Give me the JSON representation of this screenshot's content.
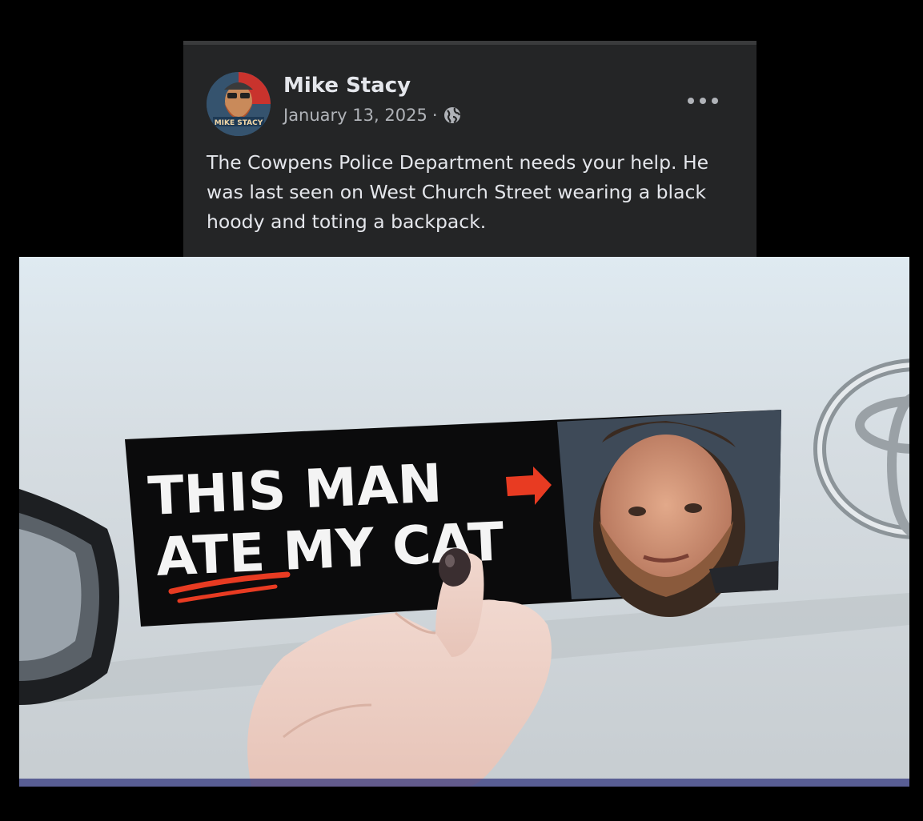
{
  "post": {
    "author": "Mike Stacy",
    "date": "January 13, 2025",
    "separator": "·",
    "audience_icon": "globe-icon",
    "more_icon": "more-options-icon",
    "text": "The Cowpens Police Department needs your help. He was last seen on West Church Street wearing a black hoody and toting a backpack.",
    "avatar_text": "MIKE STACY"
  },
  "photo": {
    "sticker_line1": "THIS MAN",
    "sticker_line2": "ATE MY CAT"
  },
  "colors": {
    "post_bg": "#242526",
    "text_primary": "#e4e6eb",
    "text_secondary": "#b0b3b8",
    "sticker_red": "#e83b22"
  }
}
